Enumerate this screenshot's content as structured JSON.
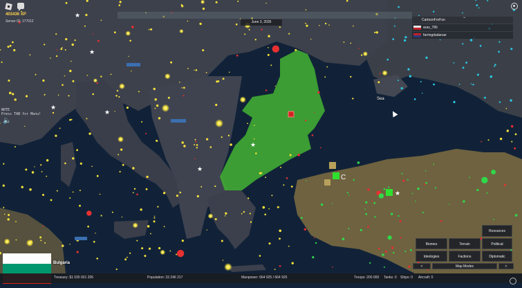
{
  "hud": {
    "xp": "403436 XP",
    "server_id": "Server ID: 177012",
    "note_line1": "NOTE",
    "note_line2": "Press TAB for Menu!",
    "date": "June 3, 2035"
  },
  "players": {
    "header": "CartoonForFun",
    "rows": [
      {
        "name": "arax_786",
        "flag": [
          "#e8e8e8",
          "#c0202a"
        ]
      },
      {
        "name": "farringdadanae",
        "flag": [
          "#c0202a",
          "#2a3a80"
        ]
      }
    ]
  },
  "map_labels": {
    "sea": "Sea",
    "c_marker": "C"
  },
  "country": {
    "name": "Bulgaria",
    "flag_colors": [
      "#ffffff",
      "#00966e",
      "#d62612"
    ]
  },
  "stats": {
    "treasury": "Treasury:   $1 035 001 205",
    "population": "Population: 33 246 217",
    "manpower": "Manpower:   664 925  /  664 925",
    "troops": "Troops: 200 000",
    "tanks": "Tanks: 0",
    "ships": "Ships: 0",
    "aircraft": "Aircraft: 0"
  },
  "mapmodes": {
    "resources": "Resources",
    "biomes": "Biomes",
    "terrain": "Terrain",
    "political": "Political",
    "ideologies": "Ideologies",
    "factions": "Factions",
    "diplomatic": "Diplomatic",
    "prev": "<",
    "title": "Map Modes",
    "next": ">"
  },
  "colors": {
    "land": "#4a4d5a",
    "sea": "#0d1a2e",
    "bulgaria": "#3fa833",
    "city_lights": "#f5e13a",
    "anatolia": "#7a6a40"
  }
}
